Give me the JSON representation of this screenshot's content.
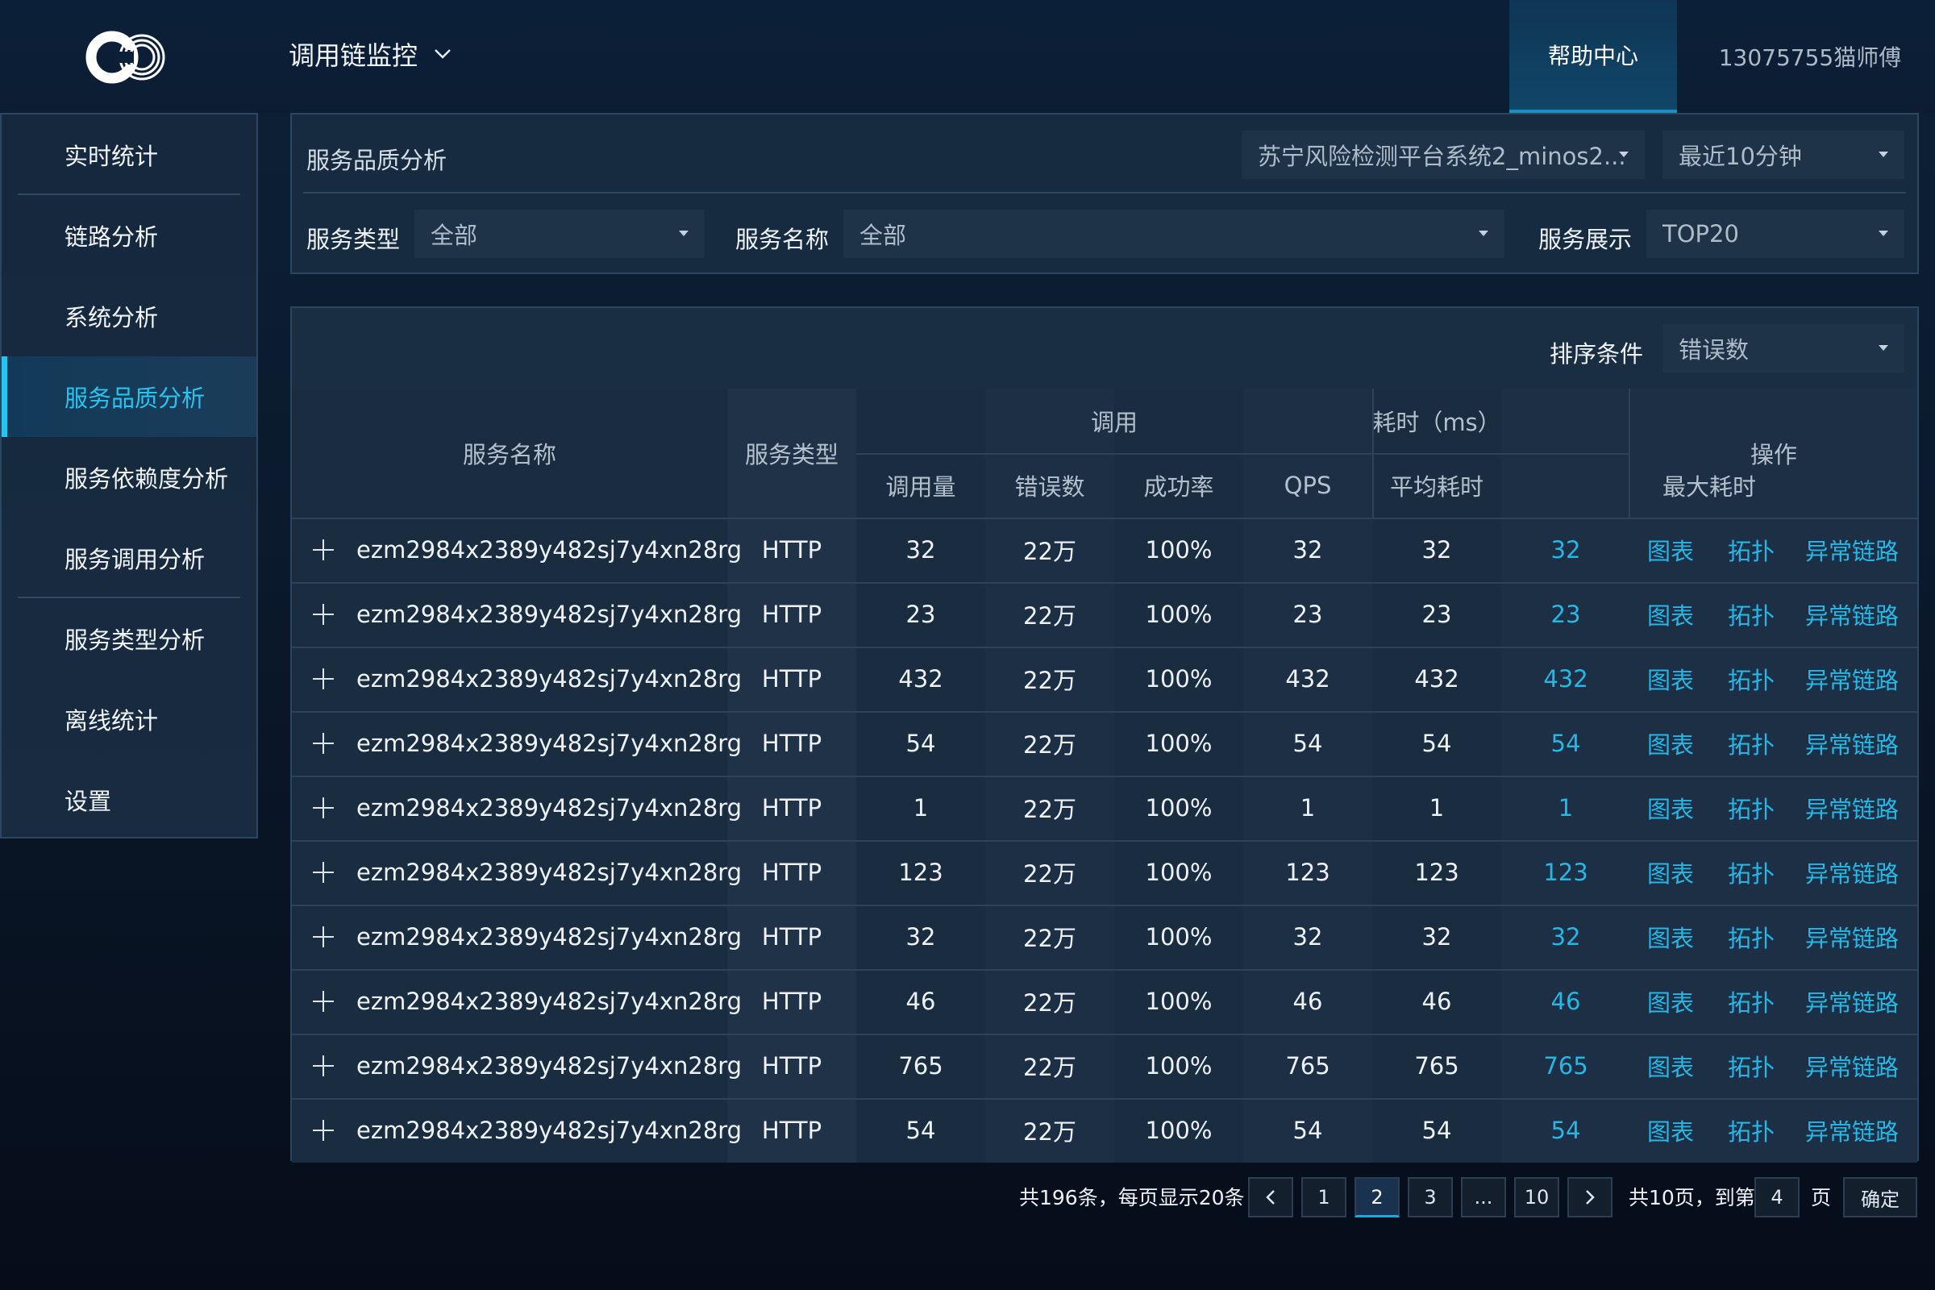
{
  "header": {
    "app_title": "调用链监控",
    "help_label": "帮助中心",
    "user_label": "13075755猫师傅"
  },
  "sidebar": {
    "items": [
      {
        "label": "实时统计"
      },
      {
        "label": "链路分析"
      },
      {
        "label": "系统分析"
      },
      {
        "label": "服务品质分析"
      },
      {
        "label": "服务依赖度分析"
      },
      {
        "label": "服务调用分析"
      },
      {
        "label": "服务类型分析"
      },
      {
        "label": "离线统计"
      },
      {
        "label": "设置"
      }
    ],
    "active_index": 3
  },
  "filters": {
    "panel_title": "服务品质分析",
    "system_select": "苏宁风险检测平台系统2_minos2...",
    "time_select": "最近10分钟",
    "service_type_label": "服务类型",
    "service_type_value": "全部",
    "service_name_label": "服务名称",
    "service_name_value": "全部",
    "service_display_label": "服务展示",
    "service_display_value": "TOP20"
  },
  "table": {
    "sort_label": "排序条件",
    "sort_value": "错误数",
    "headers": {
      "service_name": "服务名称",
      "service_type": "服务类型",
      "call_group": "调用",
      "time_group": "耗时（ms）",
      "operations": "操作",
      "call_count": "调用量",
      "error_count": "错误数",
      "success_rate": "成功率",
      "qps": "QPS",
      "avg_time": "平均耗时",
      "max_time": "最大耗时"
    },
    "actions": {
      "chart": "图表",
      "topology": "拓扑",
      "abnormal": "异常链路"
    },
    "rows": [
      {
        "name": "ezm2984x2389y482sj7y4xn28rg",
        "type": "HTTP",
        "calls": "32",
        "errors": "22万",
        "success": "100%",
        "qps": "32",
        "avg": "32",
        "max": "32"
      },
      {
        "name": "ezm2984x2389y482sj7y4xn28rg",
        "type": "HTTP",
        "calls": "23",
        "errors": "22万",
        "success": "100%",
        "qps": "23",
        "avg": "23",
        "max": "23"
      },
      {
        "name": "ezm2984x2389y482sj7y4xn28rg",
        "type": "HTTP",
        "calls": "432",
        "errors": "22万",
        "success": "100%",
        "qps": "432",
        "avg": "432",
        "max": "432"
      },
      {
        "name": "ezm2984x2389y482sj7y4xn28rg",
        "type": "HTTP",
        "calls": "54",
        "errors": "22万",
        "success": "100%",
        "qps": "54",
        "avg": "54",
        "max": "54"
      },
      {
        "name": "ezm2984x2389y482sj7y4xn28rg",
        "type": "HTTP",
        "calls": "1",
        "errors": "22万",
        "success": "100%",
        "qps": "1",
        "avg": "1",
        "max": "1"
      },
      {
        "name": "ezm2984x2389y482sj7y4xn28rg",
        "type": "HTTP",
        "calls": "123",
        "errors": "22万",
        "success": "100%",
        "qps": "123",
        "avg": "123",
        "max": "123"
      },
      {
        "name": "ezm2984x2389y482sj7y4xn28rg",
        "type": "HTTP",
        "calls": "32",
        "errors": "22万",
        "success": "100%",
        "qps": "32",
        "avg": "32",
        "max": "32"
      },
      {
        "name": "ezm2984x2389y482sj7y4xn28rg",
        "type": "HTTP",
        "calls": "46",
        "errors": "22万",
        "success": "100%",
        "qps": "46",
        "avg": "46",
        "max": "46"
      },
      {
        "name": "ezm2984x2389y482sj7y4xn28rg",
        "type": "HTTP",
        "calls": "765",
        "errors": "22万",
        "success": "100%",
        "qps": "765",
        "avg": "765",
        "max": "765"
      },
      {
        "name": "ezm2984x2389y482sj7y4xn28rg",
        "type": "HTTP",
        "calls": "54",
        "errors": "22万",
        "success": "100%",
        "qps": "54",
        "avg": "54",
        "max": "54"
      }
    ]
  },
  "pagination": {
    "total_text": "共196条，每页显示20条",
    "pages": [
      "1",
      "2",
      "3",
      "...",
      "10"
    ],
    "current_page": "2",
    "total_pages_text": "共10页，到第",
    "goto_value": "4",
    "page_suffix": "页",
    "confirm_label": "确定"
  },
  "colors": {
    "accent": "#28c4ef",
    "link": "#26b7e6",
    "panel": "#1a2e43",
    "header_bg": "#0c1d33"
  }
}
